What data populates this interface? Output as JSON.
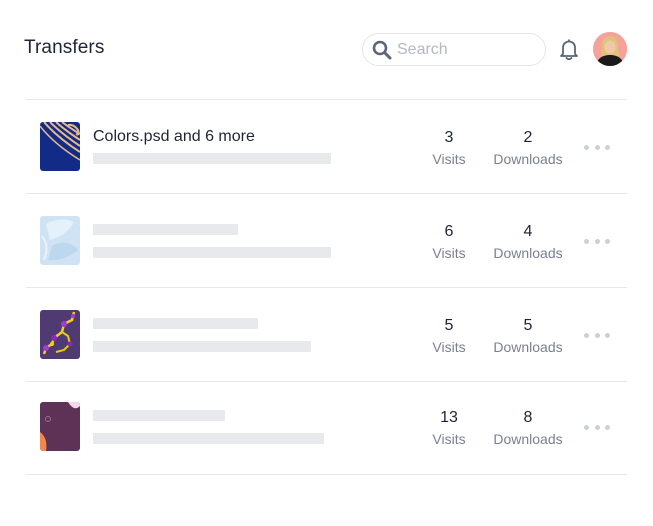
{
  "header": {
    "title": "Transfers",
    "search": {
      "placeholder": "Search",
      "value": "",
      "icon": "search-icon"
    },
    "notifications_icon": "bell-icon",
    "avatar": "user-avatar"
  },
  "transfers": [
    {
      "name": "Colors.psd and 6 more",
      "visits": "3",
      "visits_label": "Visits",
      "downloads": "2",
      "downloads_label": "Downloads",
      "thumbnail": "navy-gold-waves",
      "more_icon": "more-horizontal-icon"
    },
    {
      "name": "",
      "visits": "6",
      "visits_label": "Visits",
      "downloads": "4",
      "downloads_label": "Downloads",
      "thumbnail": "light-blue-leaves",
      "more_icon": "more-horizontal-icon"
    },
    {
      "name": "",
      "visits": "5",
      "visits_label": "Visits",
      "downloads": "5",
      "downloads_label": "Downloads",
      "thumbnail": "purple-yellow-molecules",
      "more_icon": "more-horizontal-icon"
    },
    {
      "name": "",
      "visits": "13",
      "visits_label": "Visits",
      "downloads": "8",
      "downloads_label": "Downloads",
      "thumbnail": "plum-orange-abstract",
      "more_icon": "more-horizontal-icon"
    }
  ],
  "colors": {
    "text_primary": "#1e2433",
    "text_secondary": "#7a8090",
    "skeleton": "#e8e9ed",
    "divider": "#e6e8ec",
    "avatar_bg": "#f3a39a"
  }
}
